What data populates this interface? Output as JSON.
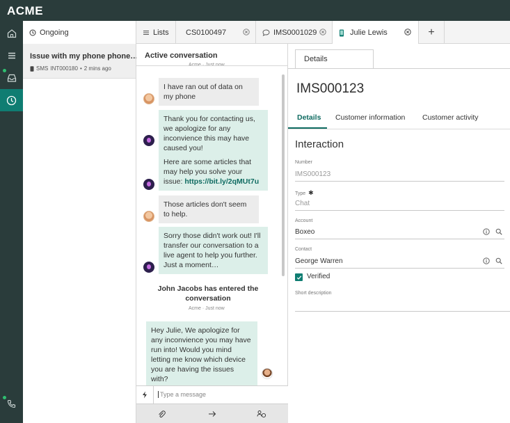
{
  "app": {
    "brand": "ACME"
  },
  "rail": {
    "icons": [
      "home-icon",
      "list-icon",
      "inbox-icon",
      "clock-icon",
      "phone-icon"
    ]
  },
  "tabs": [
    {
      "label": "Ongoing",
      "icon": "clock-icon"
    },
    {
      "label": "Lists",
      "icon": "list-icon"
    },
    {
      "label": "CS0100497",
      "icon": "",
      "closable": true
    },
    {
      "label": "IMS0001029",
      "icon": "chat-icon",
      "closable": true
    },
    {
      "label": "Julie Lewis",
      "icon": "mobile-icon",
      "closable": true
    },
    {
      "label": "+",
      "icon": "add-icon"
    }
  ],
  "ongoing": {
    "items": [
      {
        "title": "Issue with my phone phone…",
        "channel": "SMS",
        "number": "INT000180",
        "separator": "•",
        "age": "2 mins ago"
      }
    ]
  },
  "conversation": {
    "title": "Active conversation",
    "top_meta": "Acme · Just now",
    "messages": [
      {
        "from": "user",
        "text": "I have ran out of data on my phone"
      },
      {
        "from": "bot",
        "text": "Thank you for contacting us, we apologize for any inconvience this may have caused you!"
      },
      {
        "from": "bot",
        "text": "Here are some articles that may help you solve your issue:",
        "link": "https://bit.ly/2qMUt7u"
      },
      {
        "from": "user",
        "text": "Those articles don't seem to help."
      },
      {
        "from": "bot",
        "text": "Sorry those didn't work out! I'll transfer our conversation to a live agent to help you further. Just a moment…"
      },
      {
        "from": "agent",
        "text": "Hey Julie, We apologize for any inconvience you may have run into! Would you mind letting me know which device you are having the issues with?"
      }
    ],
    "system_event": {
      "text": "John Jacobs has entered the conversation",
      "meta": "Acme · Just now"
    },
    "composer": {
      "placeholder": "Type a message"
    },
    "actions": [
      "attach-icon",
      "send-icon",
      "transfer-icon"
    ]
  },
  "details": {
    "tab": "Details",
    "record_id": "IMS000123",
    "subtabs": [
      "Details",
      "Customer information",
      "Customer activity"
    ],
    "active_subtab": "Details",
    "section_title": "Interaction",
    "fields": {
      "number": {
        "label": "Number",
        "value": "IMS000123"
      },
      "type": {
        "label": "Type",
        "required_mark": "✱",
        "placeholder": "Chat"
      },
      "account": {
        "label": "Account",
        "value": "Boxeo"
      },
      "contact": {
        "label": "Contact",
        "value": "George Warren"
      },
      "verified": {
        "label": "Verified",
        "checked": true
      },
      "short_description": {
        "label": "Short description",
        "value": ""
      }
    }
  },
  "colors": {
    "rail": "#2a3c3b",
    "accent": "#0f7d72",
    "bot_bubble": "#dcefe9",
    "user_bubble": "#ececec"
  }
}
